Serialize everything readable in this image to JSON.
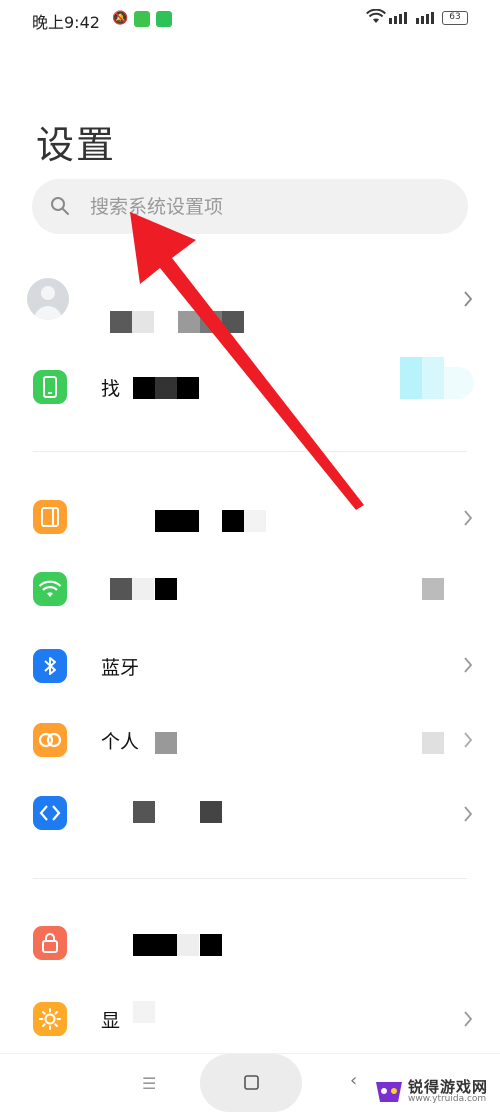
{
  "status_bar": {
    "time": "晚上9:42",
    "battery": "63"
  },
  "header": {
    "title": "设置"
  },
  "search": {
    "placeholder": "搜索系统设置项"
  },
  "items": {
    "find_device_partial": "找",
    "bluetooth": "蓝牙",
    "personal_partial": "个人",
    "display_partial": "显"
  },
  "watermark": {
    "title": "锐得游戏网",
    "url": "www.ytruida.com"
  },
  "colors": {
    "phone_icon": "#3dcb5a",
    "orange_icon": "#ff9f2f",
    "wifi_icon": "#3dcb5a",
    "bluetooth_icon": "#1f7bf2",
    "link_icon": "#ff9f2f",
    "connect_icon": "#1f7bf2",
    "lock_icon": "#f46f56",
    "display_icon": "#ffa928",
    "annotation_arrow": "#ee1c24"
  },
  "icons": [
    "search-icon",
    "chevron-right-icon",
    "phone-icon",
    "sim-card-icon",
    "wifi-icon",
    "bluetooth-icon",
    "link-icon",
    "connection-icon",
    "lock-icon",
    "sun-icon"
  ]
}
